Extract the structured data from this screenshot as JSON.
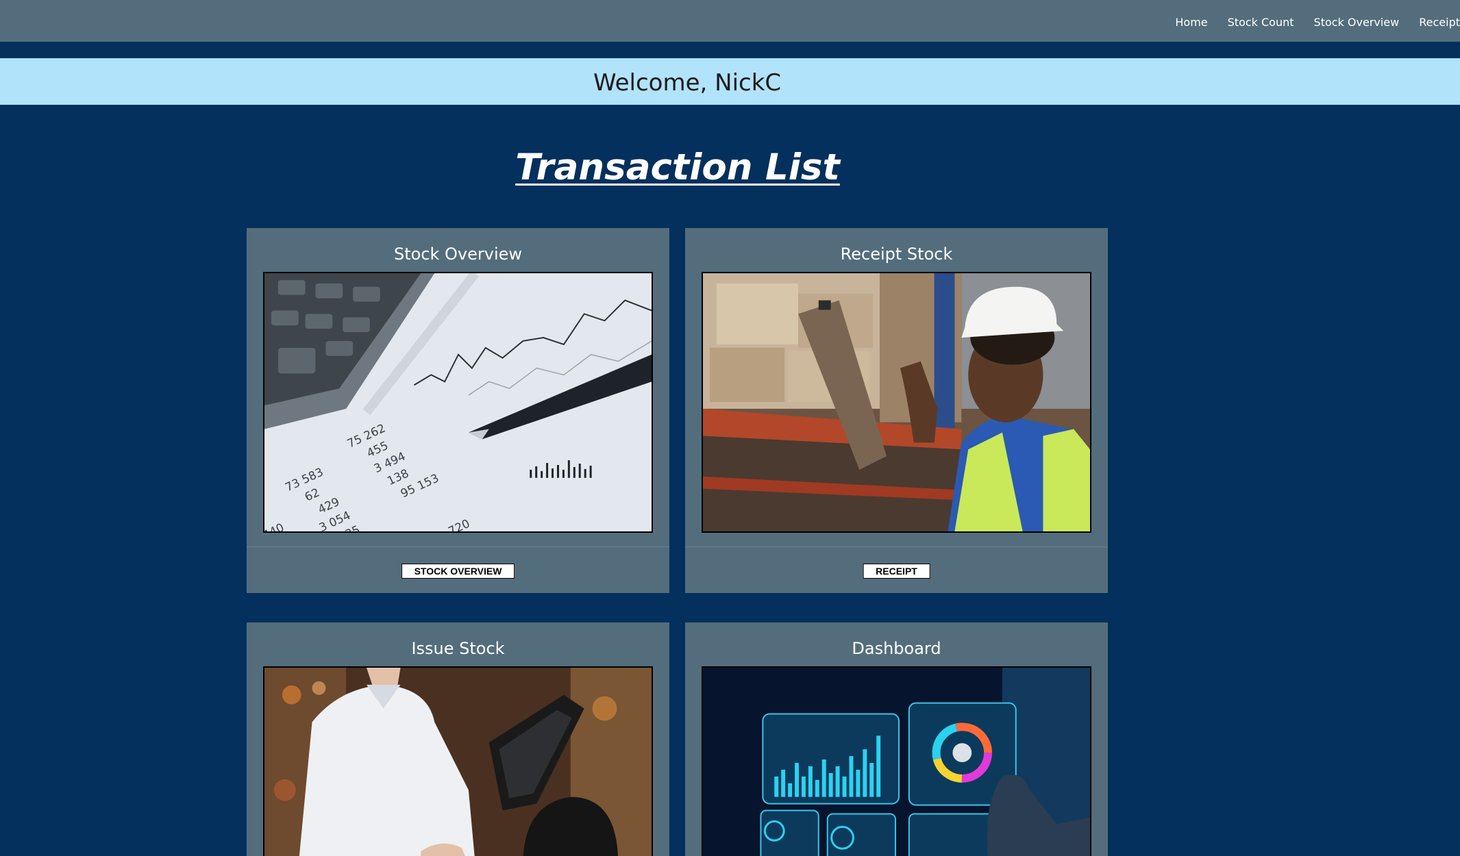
{
  "nav": {
    "items": [
      "Home",
      "Stock Count",
      "Stock Overview",
      "Receipt"
    ]
  },
  "welcome": "Welcome, NickC",
  "page_title": "Transaction List",
  "cards": [
    {
      "title": "Stock Overview",
      "button": "STOCK OVERVIEW",
      "image": "calculator-pen-spreadsheet-photo"
    },
    {
      "title": "Receipt Stock",
      "button": "RECEIPT",
      "image": "warehouse-worker-clipboard-photo"
    },
    {
      "title": "Issue Stock",
      "button": "",
      "image": "cashier-pos-terminal-photo"
    },
    {
      "title": "Dashboard",
      "button": "",
      "image": "hand-touching-dashboard-charts-photo"
    }
  ],
  "colors": {
    "page_bg": "#03305c",
    "topbar": "#536d7c",
    "welcome_bar": "#b1e3fb",
    "card_bg": "#536d7c"
  }
}
